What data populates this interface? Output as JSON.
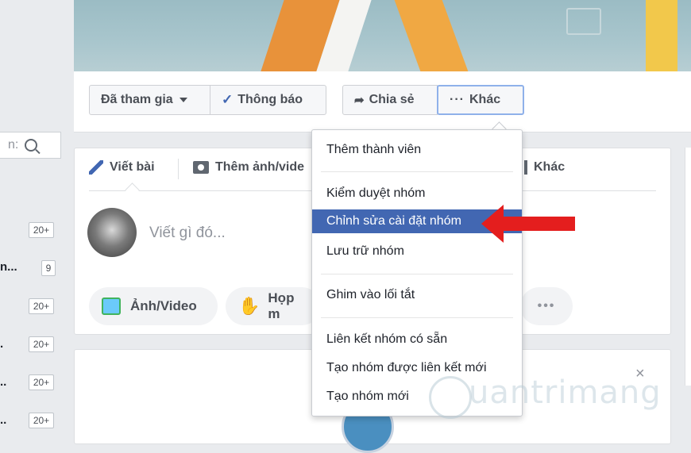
{
  "action_bar": {
    "joined_label": "Đã tham gia",
    "notify_label": "Thông báo",
    "share_label": "Chia sẻ",
    "more_label": "Khác"
  },
  "search": {
    "placeholder_fragment": "n:"
  },
  "left_list": [
    {
      "text": "",
      "badge": "20+"
    },
    {
      "text": "n...",
      "badge": "9"
    },
    {
      "text": "",
      "badge": "20+"
    },
    {
      "text": ".",
      "badge": "20+"
    },
    {
      "text": "..",
      "badge": "20+"
    },
    {
      "text": "..",
      "badge": "20+"
    }
  ],
  "composer": {
    "tab_post": "Viết bài",
    "tab_photo": "Thêm ảnh/vide",
    "tab_other": "Khác",
    "placeholder": "Viết gì đó...",
    "pill_photo": "Ảnh/Video",
    "pill_meet": "Họp m",
    "pill_more": "•••"
  },
  "menu": {
    "items": [
      "Thêm thành viên",
      "Kiểm duyệt nhóm",
      "Chỉnh sửa cài đặt nhóm",
      "Lưu trữ nhóm",
      "Ghim vào lối tắt",
      "Liên kết nhóm có sẵn",
      "Tạo nhóm được liên kết mới",
      "Tạo nhóm mới"
    ],
    "active_index": 2
  },
  "watermark": "uantrimang",
  "close_glyph": "×",
  "colors": {
    "accent": "#4267b2",
    "arrow": "#e41e1e"
  }
}
